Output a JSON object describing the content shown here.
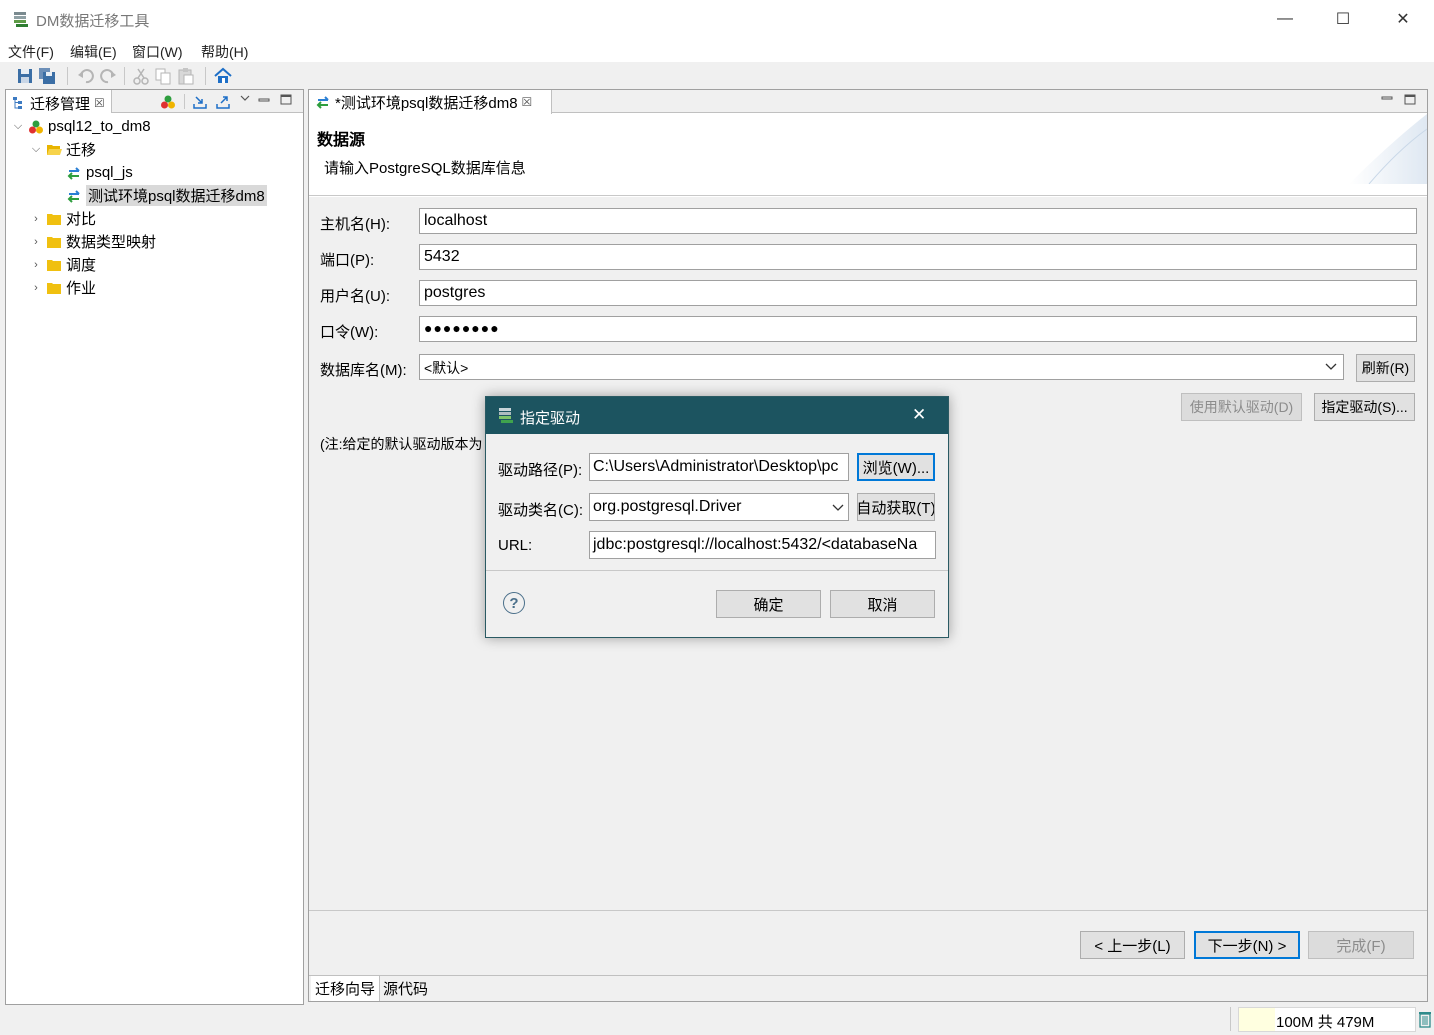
{
  "window": {
    "title": "DM数据迁移工具",
    "minimize": "—",
    "maximize": "☐",
    "close": "✕"
  },
  "menu": [
    "文件(F)",
    "编辑(E)",
    "窗口(W)",
    "帮助(H)"
  ],
  "left_view": {
    "tab_label": "迁移管理",
    "tab_close": "☒",
    "tree": [
      {
        "label": "psql12_to_dm8",
        "level": 0,
        "expanded": true,
        "icon": "project-icon"
      },
      {
        "label": "迁移",
        "level": 1,
        "expanded": true,
        "icon": "folder-open-icon"
      },
      {
        "label": "psql_js",
        "level": 2,
        "icon": "migration-icon"
      },
      {
        "label": "测试环境psql数据迁移dm8",
        "level": 2,
        "icon": "migration-icon",
        "selected": true
      },
      {
        "label": "对比",
        "level": 1,
        "expanded": false,
        "icon": "folder-icon"
      },
      {
        "label": "数据类型映射",
        "level": 1,
        "expanded": false,
        "icon": "folder-icon"
      },
      {
        "label": "调度",
        "level": 1,
        "expanded": false,
        "icon": "folder-icon"
      },
      {
        "label": "作业",
        "level": 1,
        "expanded": false,
        "icon": "folder-icon"
      }
    ]
  },
  "editor": {
    "tab_label": "*测试环境psql数据迁移dm8",
    "tab_close": "☒",
    "header_title": "数据源",
    "header_desc": "请输入PostgreSQL数据库信息",
    "host_label": "主机名(H):",
    "host_value": "localhost",
    "port_label": "端口(P):",
    "port_value": "5432",
    "user_label": "用户名(U):",
    "user_value": "postgres",
    "password_label": "口令(W):",
    "password_value": "●●●●●●●●",
    "dbname_label": "数据库名(M):",
    "dbname_value": "<默认>",
    "refresh_button": "刷新(R)",
    "use_default_driver_button": "使用默认驱动(D)",
    "specify_driver_button": "指定驱动(S)...",
    "note": "(注:给定的默认驱动版本为",
    "back_button": "< 上一步(L)",
    "next_button": "下一步(N) >",
    "finish_button": "完成(F)",
    "bottom_tabs": [
      "迁移向导",
      "源代码"
    ]
  },
  "dialog": {
    "title": "指定驱动",
    "close": "✕",
    "path_label": "驱动路径(P):",
    "path_value": "C:\\Users\\Administrator\\Desktop\\pc",
    "browse_button": "浏览(W)...",
    "class_label": "驱动类名(C):",
    "class_value": "org.postgresql.Driver",
    "auto_button": "自动获取(T)",
    "url_label": "URL:",
    "url_value": "jdbc:postgresql://localhost:5432/<databaseNa",
    "help": "?",
    "ok_button": "确定",
    "cancel_button": "取消"
  },
  "status": {
    "memory": "100M 共 479M"
  }
}
